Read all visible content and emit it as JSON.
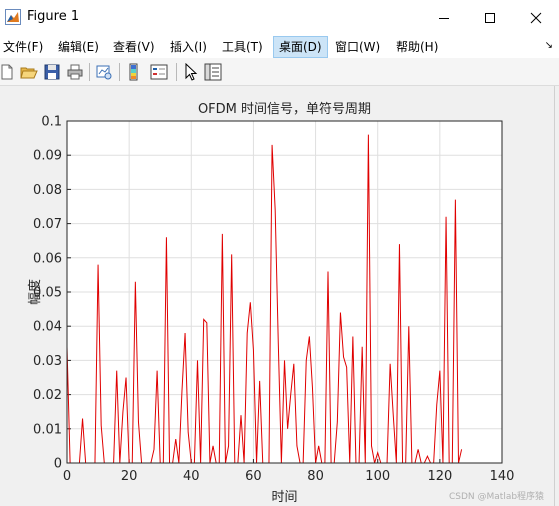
{
  "window": {
    "title": "Figure 1"
  },
  "menu": {
    "items": [
      {
        "label": "文件(F)"
      },
      {
        "label": "编辑(E)"
      },
      {
        "label": "查看(V)"
      },
      {
        "label": "插入(I)"
      },
      {
        "label": "工具(T)"
      },
      {
        "label": "桌面(D)"
      },
      {
        "label": "窗口(W)"
      },
      {
        "label": "帮助(H)"
      }
    ],
    "overflow_icon": "chevron-right-icon"
  },
  "toolbar": {
    "icons": [
      "new-figure-icon",
      "open-file-icon",
      "save-icon",
      "print-icon",
      "link-plot-icon",
      "insert-colorbar-icon",
      "insert-legend-icon",
      "pointer-icon",
      "property-inspector-icon"
    ]
  },
  "colors": {
    "line": "#e00000",
    "grid": "#dfdfdf",
    "axes_bg": "#ffffff",
    "figure_bg": "#f0f0f0",
    "menu_active": "#cce4f7"
  },
  "chart_data": {
    "type": "line",
    "title": "OFDM 时间信号，单符号周期",
    "xlabel": "时间",
    "ylabel": "幅度",
    "xlim": [
      0,
      140
    ],
    "ylim": [
      0,
      0.1
    ],
    "xticks": [
      "0",
      "20",
      "40",
      "60",
      "80",
      "100",
      "120",
      "140"
    ],
    "yticks": [
      "0",
      "0.01",
      "0.02",
      "0.03",
      "0.04",
      "0.05",
      "0.06",
      "0.07",
      "0.08",
      "0.09",
      "0.1"
    ],
    "grid": true,
    "series": [
      {
        "color": "#e00000",
        "x": [
          0,
          1,
          2,
          3,
          4,
          5,
          6,
          7,
          8,
          9,
          10,
          11,
          12,
          13,
          14,
          15,
          16,
          17,
          18,
          19,
          20,
          21,
          22,
          23,
          24,
          25,
          26,
          27,
          28,
          29,
          30,
          31,
          32,
          33,
          34,
          35,
          36,
          37,
          38,
          39,
          40,
          41,
          42,
          43,
          44,
          45,
          46,
          47,
          48,
          49,
          50,
          51,
          52,
          53,
          54,
          55,
          56,
          57,
          58,
          59,
          60,
          61,
          62,
          63,
          64,
          65,
          66,
          67,
          68,
          69,
          70,
          71,
          72,
          73,
          74,
          75,
          76,
          77,
          78,
          79,
          80,
          81,
          82,
          83,
          84,
          85,
          86,
          87,
          88,
          89,
          90,
          91,
          92,
          93,
          94,
          95,
          96,
          97,
          98,
          99,
          100,
          101,
          102,
          103,
          104,
          105,
          106,
          107,
          108,
          109,
          110,
          111,
          112,
          113,
          114,
          115,
          116,
          117,
          118,
          119,
          120,
          121,
          122,
          123,
          124,
          125,
          126,
          127
        ],
        "y": [
          0.034,
          0,
          0,
          0,
          0,
          0.013,
          0,
          0,
          0,
          0,
          0.058,
          0.011,
          0,
          0,
          0,
          0,
          0.027,
          0,
          0.015,
          0.025,
          0,
          0,
          0.053,
          0.012,
          0,
          0,
          0,
          0,
          0.004,
          0.027,
          0,
          0,
          0.066,
          0,
          0,
          0.007,
          0,
          0.021,
          0.038,
          0.009,
          0,
          0,
          0.03,
          0,
          0.042,
          0.041,
          0,
          0.005,
          0,
          0,
          0.067,
          0,
          0.005,
          0.061,
          0,
          0,
          0.014,
          0,
          0.038,
          0.047,
          0.033,
          0,
          0.024,
          0,
          0,
          0,
          0.093,
          0.074,
          0.035,
          0,
          0.03,
          0.01,
          0.02,
          0.029,
          0.005,
          0,
          0,
          0.03,
          0.037,
          0.022,
          0,
          0.005,
          0,
          0,
          0.056,
          0,
          0,
          0.012,
          0.044,
          0.031,
          0.028,
          0,
          0.037,
          0,
          0,
          0.034,
          0,
          0.096,
          0.005,
          0,
          0.003,
          0,
          0,
          0,
          0.029,
          0.014,
          0,
          0.064,
          0,
          0,
          0.04,
          0,
          0,
          0.004,
          0,
          0,
          0.002,
          0,
          0,
          0.017,
          0.027,
          0,
          0.072,
          0,
          0,
          0.077,
          0,
          0.004
        ]
      }
    ]
  },
  "watermark": "CSDN @Matlab程序猿"
}
